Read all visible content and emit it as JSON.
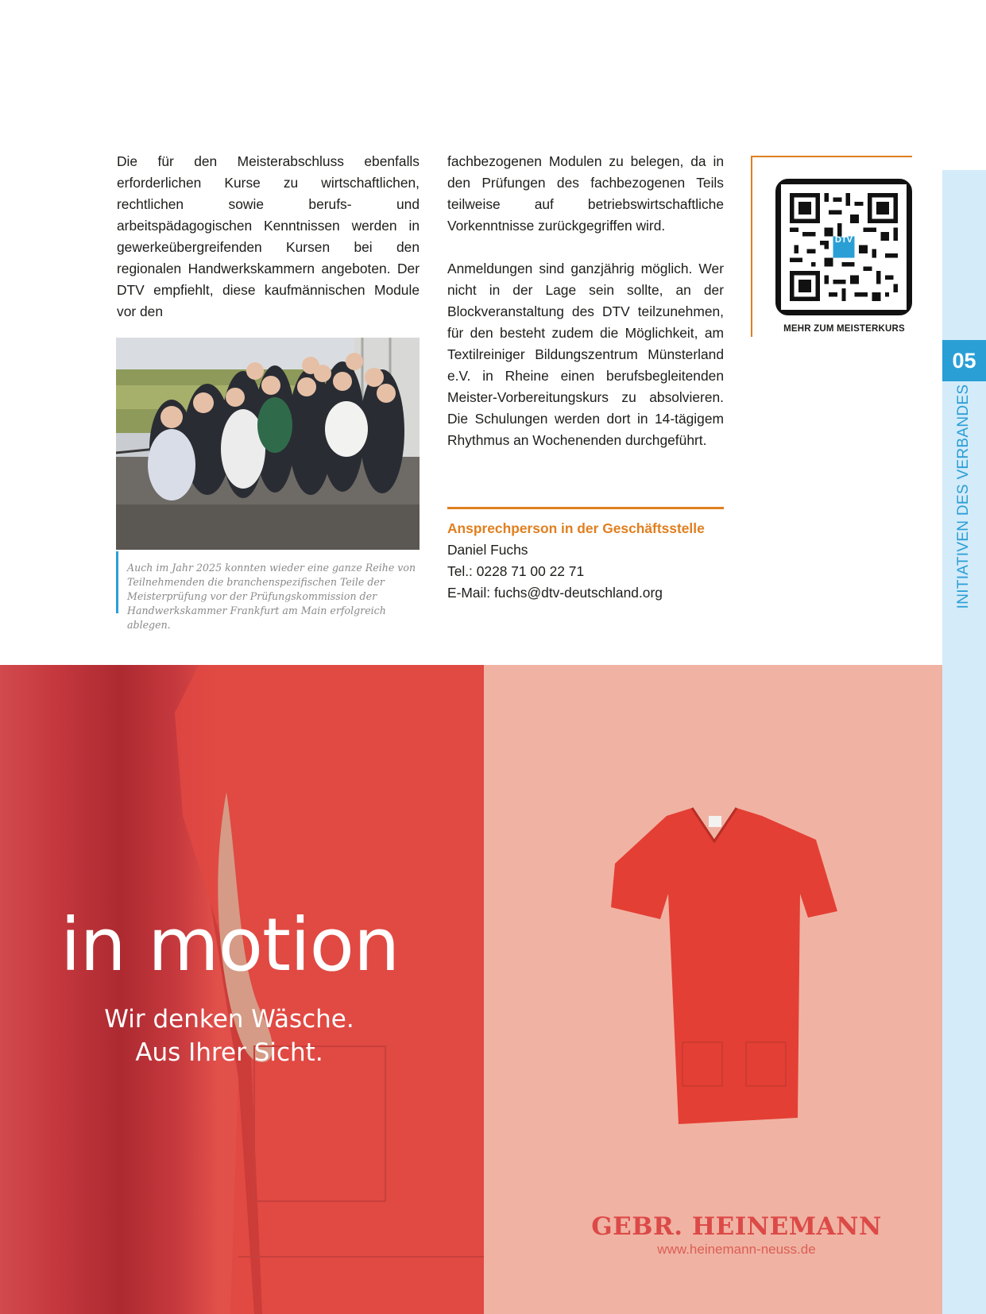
{
  "column1": {
    "paragraph": "Die für den Meisterabschluss ebenfalls erforderlichen Kurse zu wirtschaftlichen, rechtlichen sowie berufs- und arbeitspädagogischen Kenntnissen werden in gewerkeübergreifenden Kursen bei den regionalen Handwerkskammern angeboten. Der DTV empfiehlt, diese kaufmännischen Module vor den"
  },
  "column2": {
    "paragraph1": "fachbezogenen Modulen zu belegen, da in den Prüfungen des fachbezogenen Teils teilweise auf betriebswirtschaftliche Vorkenntnisse zurückgegriffen wird.",
    "paragraph2": "Anmeldungen sind ganzjährig möglich. Wer nicht in der Lage sein sollte, an der Blockveranstaltung des DTV teilzunehmen, für den besteht zudem die Möglichkeit, am Textilreiniger Bildungszentrum Münsterland e.V. in Rheine einen berufsbegleitenden Meister-Vorbereitungskurs zu absolvieren. Die Schulungen werden dort in 14-tägigem Rhythmus an Wochenenden durchgeführt."
  },
  "photo": {
    "caption": "Auch im Jahr 2025 konnten wieder eine ganze Reihe von Teilnehmenden die branchenspezifischen Teile der Meisterprüfung vor der Prüfungskommission der Handwerkskammer Frankfurt am Main erfolgreich ablegen."
  },
  "contact": {
    "heading": "Ansprechperson in der Geschäftsstelle",
    "name": "Daniel Fuchs",
    "phone": "Tel.: 0228 71 00 22 71",
    "email": "E-Mail: fuchs@dtv-deutschland.org"
  },
  "qr": {
    "logo_text": "DTV",
    "label": "MEHR ZUM MEISTERKURS"
  },
  "side_tab": {
    "number": "05",
    "section": "INITIATIVEN DES VERBANDES"
  },
  "ad": {
    "headline": "in motion",
    "subline1": "Wir denken Wäsche.",
    "subline2": "Aus Ihrer Sicht.",
    "brand": "GEBR. HEINEMANN",
    "url": "www.heinemann-neuss.de"
  },
  "colors": {
    "accent_orange": "#e07f1f",
    "accent_blue": "#2a9fd6",
    "side_strip": "#d4ebfa",
    "ad_red": "#e5524b",
    "ad_salmon": "#f0b3a3",
    "brand_red": "#dc4a48"
  }
}
